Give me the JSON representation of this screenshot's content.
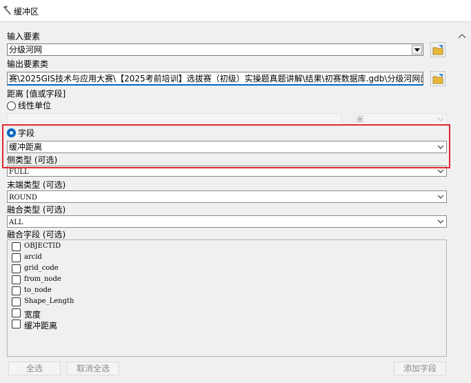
{
  "window": {
    "title": "缓冲区",
    "icon": "hammer-icon"
  },
  "input_features": {
    "label": "输入要素",
    "value": "分级河网"
  },
  "output_feature_class": {
    "label": "输出要素类",
    "value": "赛\\2025GIS技术与应用大赛\\【2025考前培训】选拔赛（初级）实操题真题讲解\\结果\\初赛数据库.gdb\\分级河网面"
  },
  "distance": {
    "label": "距离 [值或字段]",
    "linear_unit_label": "线性单位",
    "unit_placeholder": "米",
    "field_label": "字段",
    "field_value": "缓冲距离"
  },
  "side_type": {
    "label": "侧类型 (可选)",
    "value": "FULL"
  },
  "end_type": {
    "label": "末端类型 (可选)",
    "value": "ROUND"
  },
  "dissolve_type": {
    "label": "融合类型 (可选)",
    "value": "ALL"
  },
  "dissolve_fields": {
    "label": "融合字段 (可选)",
    "items": [
      "OBJECTID",
      "arcid",
      "grid_code",
      "from_node",
      "to_node",
      "Shape_Length",
      "宽度",
      "缓冲距离"
    ]
  },
  "buttons": {
    "select_all": "全选",
    "clear_all": "取消全选",
    "add_field": "添加字段"
  },
  "colors": {
    "highlight": "#e0262e",
    "accent": "#0067c0"
  }
}
